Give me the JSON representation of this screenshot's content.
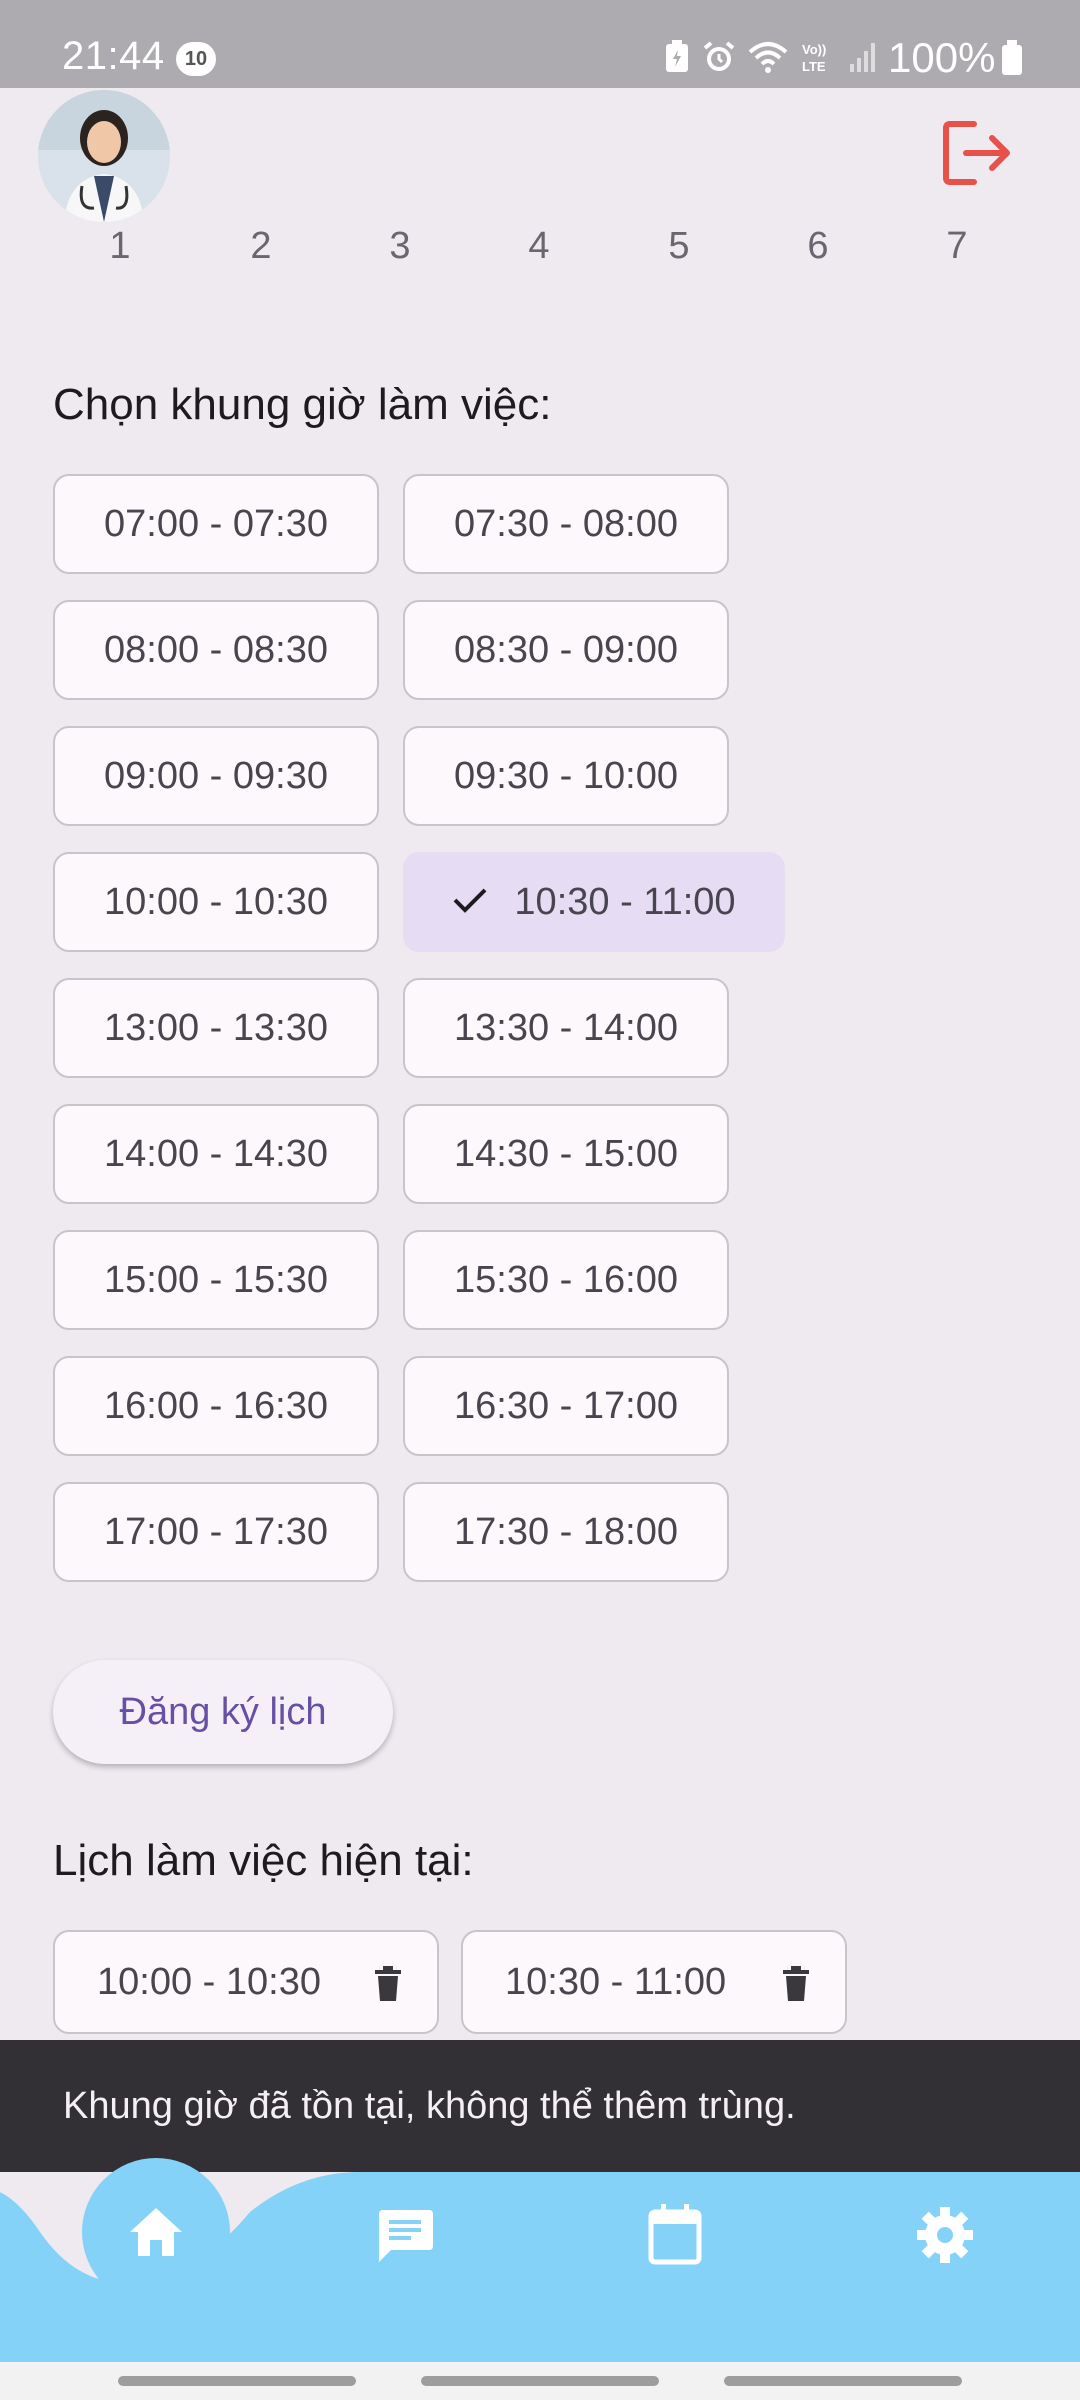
{
  "status_bar": {
    "time": "21:44",
    "notification_count": "10",
    "battery_percent": "100%"
  },
  "header": {
    "avatar_alt": "doctor avatar",
    "logout_icon": "logout-icon",
    "logout_color": "#e8514a"
  },
  "day_selector": {
    "days": [
      "1",
      "2",
      "3",
      "4",
      "5",
      "6",
      "7"
    ]
  },
  "slot_section": {
    "title": "Chọn khung giờ làm việc:",
    "slots": [
      {
        "label": "07:00 - 07:30",
        "selected": false
      },
      {
        "label": "07:30 - 08:00",
        "selected": false
      },
      {
        "label": "08:00 - 08:30",
        "selected": false
      },
      {
        "label": "08:30 - 09:00",
        "selected": false
      },
      {
        "label": "09:00 - 09:30",
        "selected": false
      },
      {
        "label": "09:30 - 10:00",
        "selected": false
      },
      {
        "label": "10:00 - 10:30",
        "selected": false
      },
      {
        "label": "10:30 - 11:00",
        "selected": true
      },
      {
        "label": "13:00 - 13:30",
        "selected": false
      },
      {
        "label": "13:30 - 14:00",
        "selected": false
      },
      {
        "label": "14:00 - 14:30",
        "selected": false
      },
      {
        "label": "14:30 - 15:00",
        "selected": false
      },
      {
        "label": "15:00 - 15:30",
        "selected": false
      },
      {
        "label": "15:30 - 16:00",
        "selected": false
      },
      {
        "label": "16:00 - 16:30",
        "selected": false
      },
      {
        "label": "16:30 - 17:00",
        "selected": false
      },
      {
        "label": "17:00 - 17:30",
        "selected": false
      },
      {
        "label": "17:30 - 18:00",
        "selected": false
      }
    ]
  },
  "register_button": {
    "label": "Đăng ký lịch"
  },
  "current_schedule": {
    "title": "Lịch làm việc hiện tại:",
    "items": [
      {
        "label": "10:00 - 10:30"
      },
      {
        "label": "10:30 - 11:00"
      }
    ]
  },
  "snackbar": {
    "message": "Khung giờ đã tồn tại, không thể thêm trùng."
  },
  "bottom_nav": {
    "items": [
      {
        "icon": "home-icon",
        "active": true
      },
      {
        "icon": "chat-icon",
        "active": false
      },
      {
        "icon": "calendar-icon",
        "active": false
      },
      {
        "icon": "settings-icon",
        "active": false
      }
    ],
    "background_color": "#85d2f8"
  },
  "colors": {
    "accent": "#6750a4",
    "selected_chip": "#e6ddf4",
    "background": "#efeaf0"
  }
}
